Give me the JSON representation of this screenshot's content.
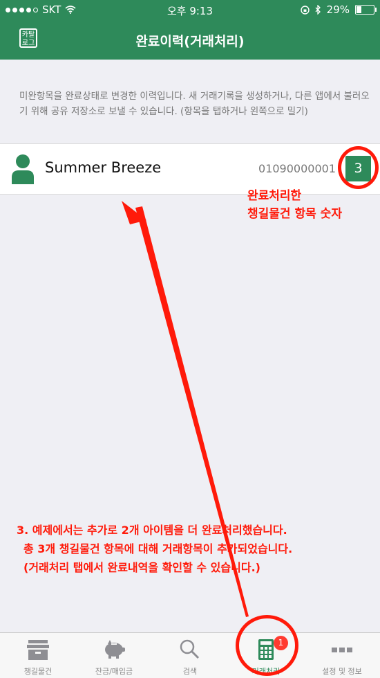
{
  "status_bar": {
    "carrier": "SKT",
    "time": "오후 9:13",
    "battery": "29%"
  },
  "header": {
    "title": "완료이력(거래처리)",
    "logo_text": "카탈로그"
  },
  "description": "미완항목을 완료상태로 변경한 이력입니다. 새 거래기록을 생성하거나, 다른 앱에서 불러오기 위해 공유 저장소로 보낼 수 있습니다. (항목을 탭하거나 왼쪽으로 밀기)",
  "list": [
    {
      "name": "Summer Breeze",
      "phone": "01090000001",
      "count": "3"
    }
  ],
  "annotations": {
    "count_note": [
      "완료처리한",
      "챙길물건 항목 숫자"
    ],
    "main_note": [
      "3. 예제에서는 추가로 2개 아이템을 더 완료처리했습니다.",
      "총 3개 챙길물건 항목에 대해 거래항목이 추가되었습니다.",
      "(거래처리 탭에서 완료내역을 확인할 수 있습니다.)"
    ]
  },
  "tabs": [
    {
      "label": "챙길물건",
      "icon": "box-icon"
    },
    {
      "label": "잔금/매입금",
      "icon": "piggy-bank-icon"
    },
    {
      "label": "검색",
      "icon": "search-icon"
    },
    {
      "label": "거래처리",
      "icon": "calculator-icon",
      "badge": "1",
      "active": true
    },
    {
      "label": "설정 및 정보",
      "icon": "more-icon"
    }
  ],
  "colors": {
    "brand": "#2e8a5a",
    "annotation": "#ff1a0a",
    "badge": "#ff3b30"
  }
}
